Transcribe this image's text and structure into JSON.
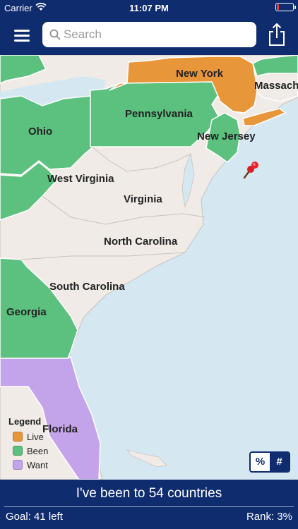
{
  "status_bar": {
    "carrier": "Carrier",
    "time": "11:07 PM"
  },
  "nav": {
    "search_placeholder": "Search",
    "menu_icon": "hamburger-menu-icon",
    "share_icon": "share-icon"
  },
  "map": {
    "states": {
      "new_york": "New York",
      "massachusetts": "Massach",
      "pennsylvania": "Pennsylvania",
      "new_jersey": "New Jersey",
      "ohio": "Ohio",
      "west_virginia": "West Virginia",
      "virginia": "Virginia",
      "north_carolina": "North Carolina",
      "south_carolina": "South Carolina",
      "georgia": "Georgia",
      "florida": "Florida"
    },
    "colors": {
      "live": "#e8963a",
      "been": "#5cc07f",
      "want": "#c3a4ea",
      "land": "#f0ebe6",
      "water": "#d5e8f2"
    }
  },
  "legend": {
    "title": "Legend",
    "items": [
      {
        "label": "Live",
        "color": "#e8963a"
      },
      {
        "label": "Been",
        "color": "#5cc07f"
      },
      {
        "label": "Want",
        "color": "#c3a4ea"
      }
    ]
  },
  "toggle": {
    "percent": "%",
    "count": "#"
  },
  "footer": {
    "headline": "I've been to 54 countries",
    "goal": "Goal: 41 left",
    "rank": "Rank: 3%"
  }
}
